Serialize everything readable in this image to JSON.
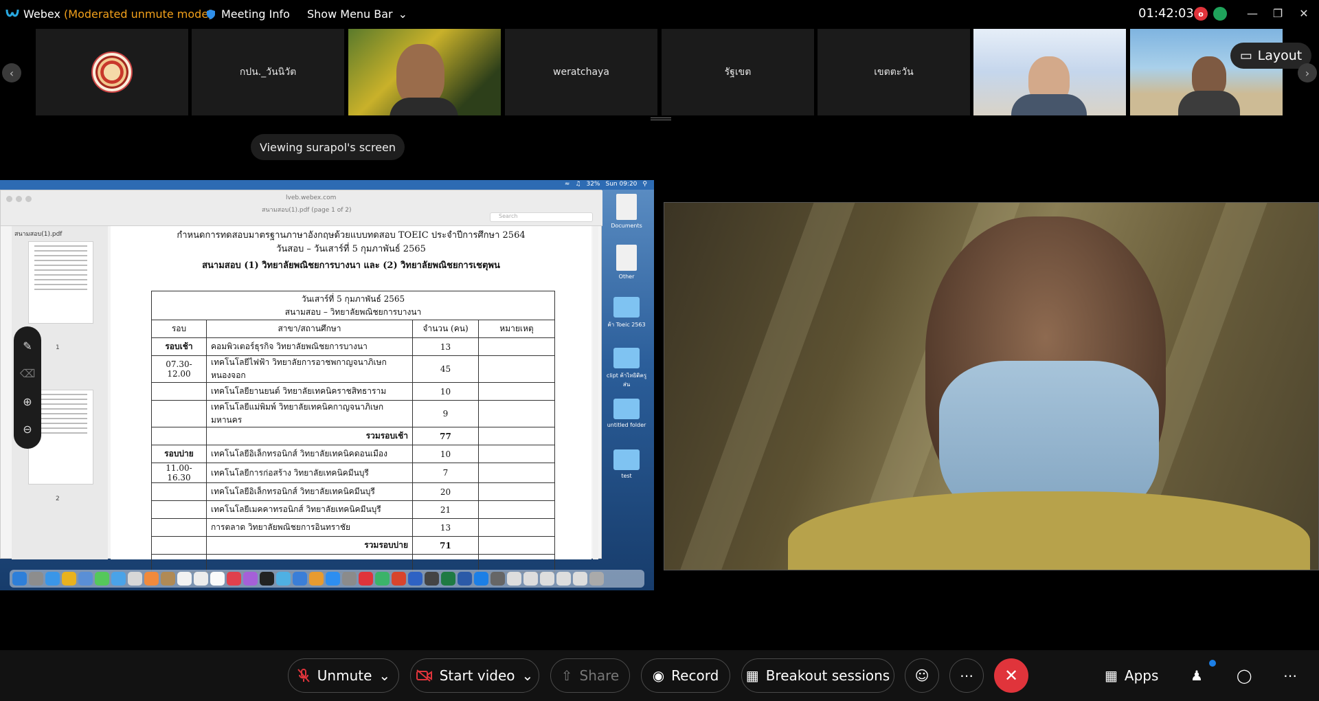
{
  "titlebar": {
    "app_name": "Webex",
    "mode": "(Moderated unmute mode)",
    "meeting_info": "Meeting Info",
    "show_menu_bar": "Show Menu Bar",
    "time": "01:42:03",
    "rec_indicator": "o"
  },
  "filmstrip": {
    "participants": [
      "กปน._วันนิวัต",
      "weratchaya",
      "รัฐเขต",
      "เขตตะวัน"
    ],
    "layout_label": "Layout"
  },
  "viewing_label": "Viewing surapol's screen",
  "shared_screen": {
    "menubar_time": "Sun 09:20",
    "menubar_battery": "32%",
    "url": "lveb.webex.com",
    "window_title": "สนามสอบ(1).pdf (page 1 of 2)",
    "search_placeholder": "Search",
    "sidebar_file": "สนามสอบ(1).pdf",
    "thumb_numbers": [
      "1",
      "2"
    ],
    "doc": {
      "line1": "กำหนดการทดสอบมาตรฐานภาษาอังกฤษด้วยแบบทดสอบ TOEIC ประจำปีการศึกษา 2564",
      "line2": "วันสอบ – วันเสาร์ที่ 5 กุมภาพันธ์ 2565",
      "line3": "สนามสอบ (1) วิทยาลัยพณิชยการบางนา และ (2) วิทยาลัยพณิชยการเชตุพน",
      "table_title1": "วันเสาร์ที่ 5 กุมภาพันธ์ 2565",
      "table_title2": "สนามสอบ – วิทยาลัยพณิชยการบางนา",
      "headers": [
        "รอบ",
        "สาขา/สถานศึกษา",
        "จำนวน (คน)",
        "หมายเหตุ"
      ],
      "rows": [
        [
          "รอบเช้า",
          "คอมพิวเตอร์ธุรกิจ วิทยาลัยพณิชยการบางนา",
          "13",
          ""
        ],
        [
          "07.30-12.00",
          "เทคโนโลยีไฟฟ้า วิทยาลัยการอาชพกาญจนาภิเษกหนองจอก",
          "45",
          ""
        ],
        [
          "",
          "เทคโนโลยียานยนต์ วิทยาลัยเทคนิคราชสิทธาราม",
          "10",
          ""
        ],
        [
          "",
          "เทคโนโลยีแม่พิมพ์ วิทยาลัยเทคนิคกาญจนาภิเษก มหานคร",
          "9",
          ""
        ],
        [
          "",
          "รวมรอบเช้า",
          "77",
          ""
        ],
        [
          "รอบบ่าย",
          "เทคโนโลยีอิเล็กทรอนิกส์ วิทยาลัยเทคนิคดอนเมือง",
          "10",
          ""
        ],
        [
          "11.00-16.30",
          "เทคโนโลยีการก่อสร้าง วิทยาลัยเทคนิคมีนบุรี",
          "7",
          ""
        ],
        [
          "",
          "เทคโนโลยีอิเล็กทรอนิกส์ วิทยาลัยเทคนิคมีนบุรี",
          "20",
          ""
        ],
        [
          "",
          "เทคโนโลยีเมคคาทรอนิกส์ วิทยาลัยเทคนิคมีนบุรี",
          "21",
          ""
        ],
        [
          "",
          "การตลาด วิทยาลัยพณิชยการอินทราชัย",
          "13",
          ""
        ],
        [
          "",
          "รวมรอบบ่าย",
          "71",
          ""
        ],
        [
          "",
          "",
          "",
          ""
        ]
      ]
    },
    "desktop_icons": [
      "Documents",
      "Other",
      "ค้า Toeic 2563",
      "clipt ค้าไทยิติครูส่น",
      "untitled folder",
      "test"
    ]
  },
  "controls": {
    "unmute": "Unmute",
    "start_video": "Start video",
    "share": "Share",
    "record": "Record",
    "breakout": "Breakout sessions",
    "apps": "Apps"
  },
  "colors": {
    "accent_orange": "#f3a11b",
    "end_red": "#e0343b",
    "webex_blue": "#1c7fe6"
  }
}
